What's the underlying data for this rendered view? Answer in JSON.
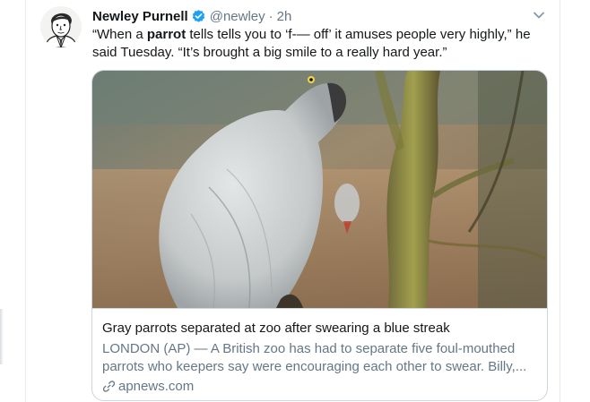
{
  "tweet": {
    "author_name": "Newley Purnell",
    "handle": "@newley",
    "separator": "·",
    "time": "2h",
    "text_before": "“When a ",
    "text_bold": "parrot",
    "text_after": " tells tells you to ‘f-— off’ it amuses people very highly,” he said Tuesday. “It’s brought a big smile to a really hard year.”",
    "icons": {
      "verified": "verified-badge-icon",
      "menu": "chevron-down-icon",
      "link": "link-icon"
    }
  },
  "card": {
    "title": "Gray parrots separated at zoo after swearing a blue streak",
    "description": "LONDON (AP) — A British zoo has had to separate five foul-mouthed parrots who keepers say were encouraging each other to swear. Billy,...",
    "domain": "apnews.com"
  },
  "colors": {
    "verified_blue": "#1da1f2",
    "secondary_text": "#657786",
    "border": "#ccd6dd"
  }
}
